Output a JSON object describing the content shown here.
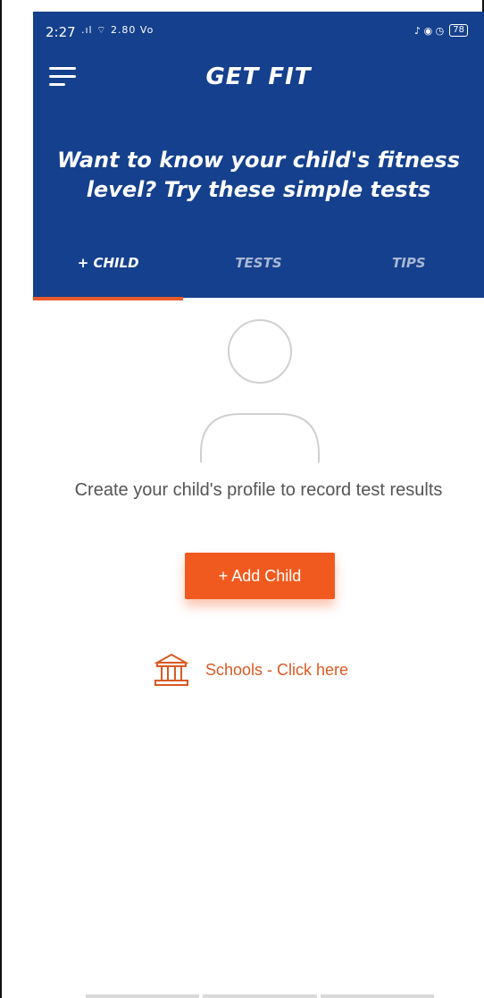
{
  "status_bar": {
    "time": "2:27",
    "signal": ".ıl ⌔ 2.80 Vo",
    "icons_right": "♪ ◉ ◷",
    "battery": "78"
  },
  "header": {
    "title": "GET FIT",
    "headline": "Want to know your child's fitness level? Try these simple tests"
  },
  "tabs": [
    {
      "label": "+ CHILD",
      "active": true
    },
    {
      "label": "TESTS",
      "active": false
    },
    {
      "label": "TIPS",
      "active": false
    }
  ],
  "main": {
    "empty_message": "Create your child's profile to record test results",
    "add_child_label": "+ Add Child",
    "schools_link_label": "Schools - Click here"
  },
  "colors": {
    "brand_blue": "#15408d",
    "accent_orange": "#f15a1f",
    "link_orange": "#d85a24"
  },
  "icons": [
    "menu-icon",
    "avatar-placeholder-icon",
    "school-building-icon"
  ]
}
